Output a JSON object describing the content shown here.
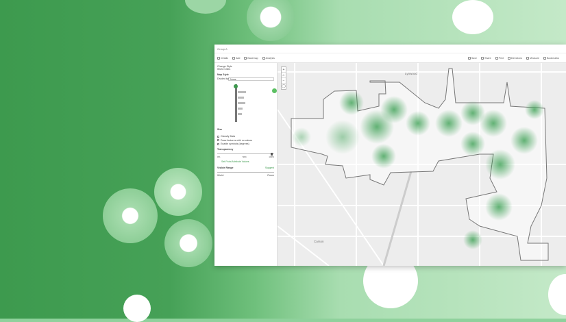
{
  "window": {
    "title": "Group A"
  },
  "toolbar": {
    "left": [
      "Details",
      "Add",
      "Basemap",
      "Analysis"
    ],
    "right": [
      "Save",
      "Share",
      "Print",
      "Directions",
      "Measure",
      "Bookmarks"
    ]
  },
  "panel": {
    "title": "Change Style",
    "layer": "World Cities",
    "section": "Map Style",
    "style_by_label": "Divided by",
    "style_by_value": "None",
    "size_label": "Size",
    "checkboxes": [
      "Classify Data",
      "Draw features with no values",
      "Enable symbols (degrees)"
    ],
    "transparency_label": "Transparency",
    "transparency_ticks": [
      "0%",
      "50%",
      "100%"
    ],
    "visible_range_label": "Visible Range",
    "visible_range_link": "Suggest",
    "range_min": "World",
    "range_max": "Room",
    "more_options": "Set Point Attribute Values"
  },
  "map": {
    "labels": [
      "Lynwood",
      "Carson"
    ],
    "zoom_in": "+",
    "zoom_out": "−"
  },
  "colors": {
    "accent": "#3d9a4e",
    "heat": "#2f9a48"
  }
}
